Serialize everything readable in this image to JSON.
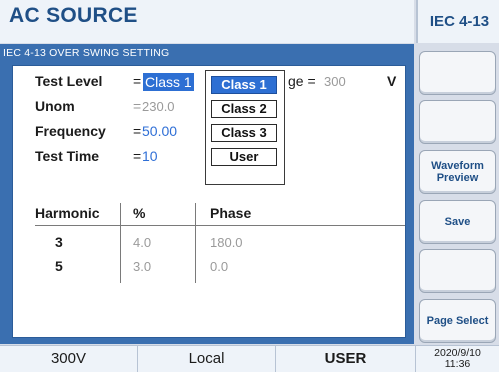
{
  "header": {
    "title": "AC SOURCE",
    "standard": "IEC 4-13"
  },
  "panel": {
    "title": "IEC 4-13 OVER SWING SETTING",
    "test_level": {
      "label": "Test Level",
      "eq": "=",
      "value": "Class 1"
    },
    "voltage": {
      "label_fragment": "ge =",
      "value": "300",
      "unit": "V"
    },
    "unom": {
      "label": "Unom",
      "eq": "=",
      "value": "230.0"
    },
    "frequency": {
      "label": "Frequency",
      "eq": "=",
      "value": "50.00"
    },
    "test_time": {
      "label": "Test Time",
      "eq": "=",
      "value": "10"
    },
    "dropdown": {
      "options": [
        "Class 1",
        "Class 2",
        "Class 3",
        "User"
      ],
      "selected": "Class 1"
    },
    "table": {
      "headers": [
        "Harmonic",
        "%",
        "Phase"
      ],
      "rows": [
        {
          "harmonic": "3",
          "percent": "4.0",
          "phase": "180.0"
        },
        {
          "harmonic": "5",
          "percent": "3.0",
          "phase": "0.0"
        }
      ]
    }
  },
  "softkeys": [
    "",
    "",
    "Waveform Preview",
    "Save",
    "",
    "Page Select"
  ],
  "status": {
    "voltage": "300V",
    "mode": "Local",
    "user": "USER",
    "date": "2020/9/10",
    "time": "11:36"
  },
  "colors": {
    "accent_blue": "#2d6fd3",
    "panel_blue": "#3a6fb0",
    "title_blue": "#1f4f86"
  }
}
